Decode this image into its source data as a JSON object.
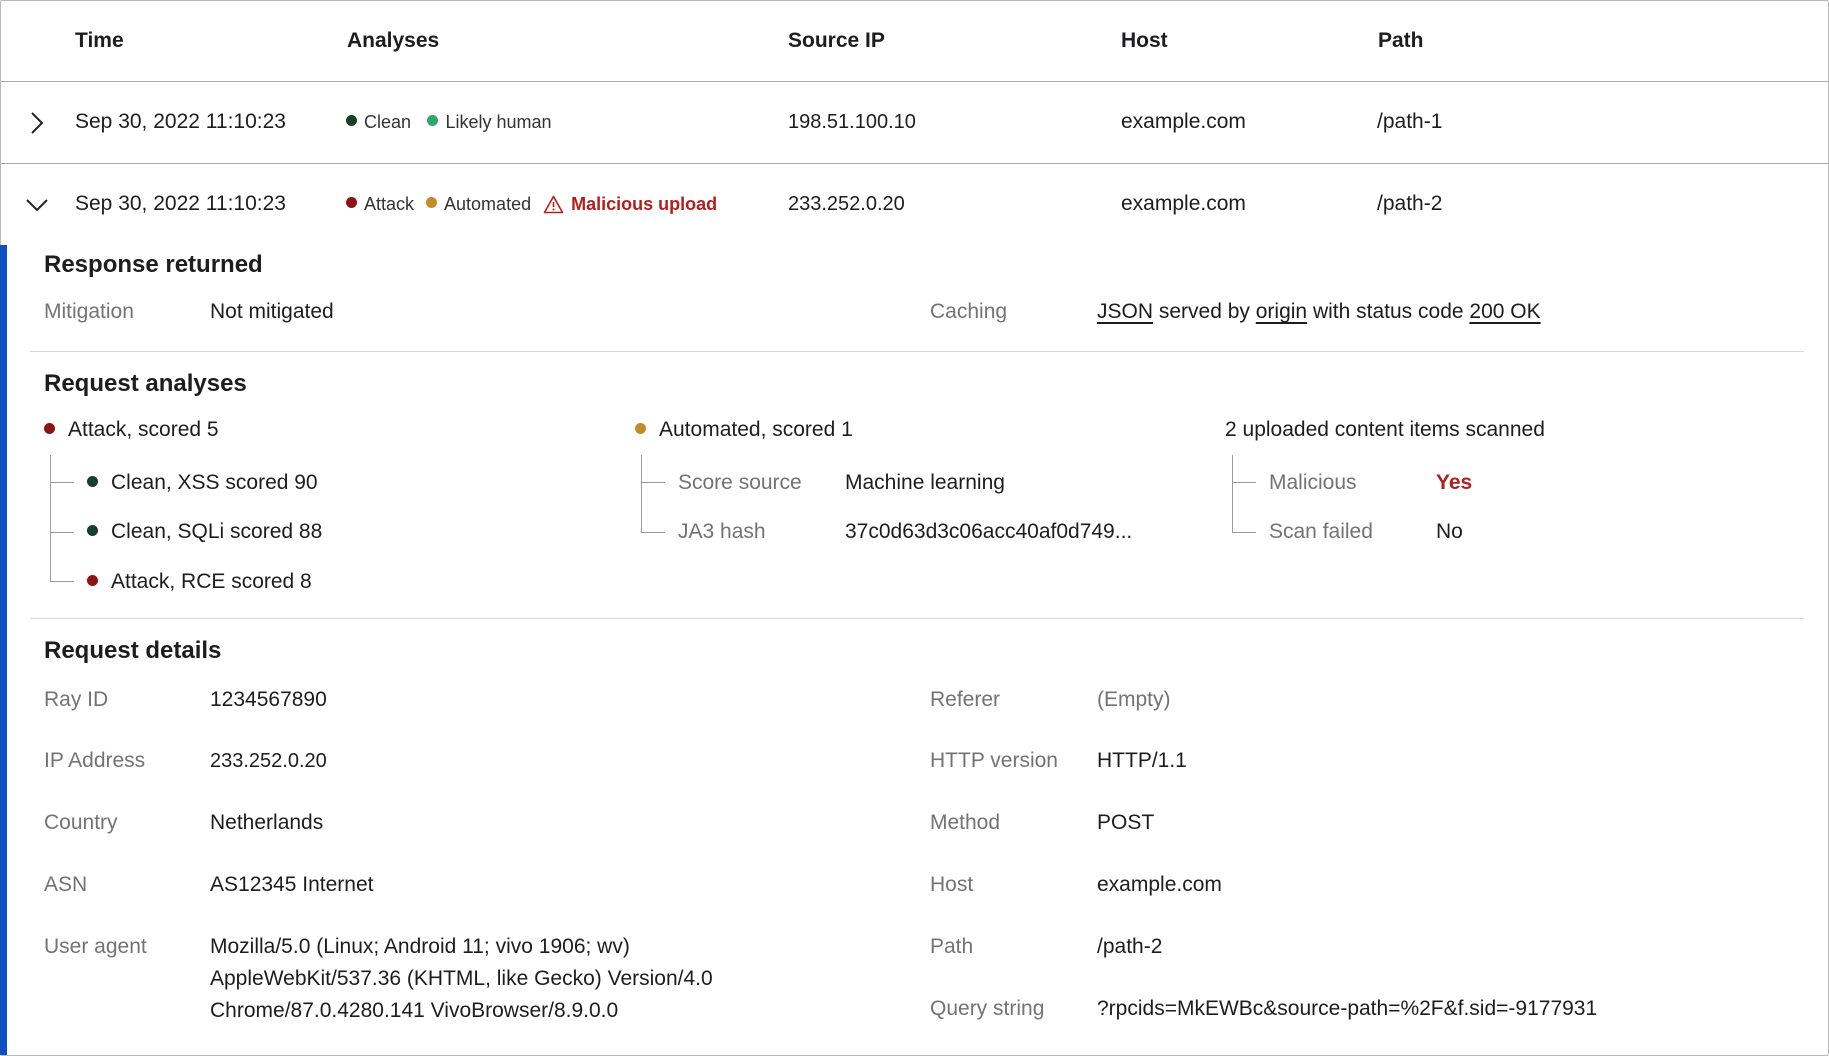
{
  "table": {
    "headers": {
      "time": "Time",
      "analyses": "Analyses",
      "source_ip": "Source IP",
      "host": "Host",
      "path": "Path"
    },
    "rows": [
      {
        "time": "Sep 30, 2022 11:10:23",
        "analyses": [
          {
            "label": "Clean",
            "color": "#173f2a"
          },
          {
            "label": "Likely human",
            "color": "#2fa66a"
          }
        ],
        "source_ip": "198.51.100.10",
        "host": "example.com",
        "path": "/path-1",
        "expanded": false
      },
      {
        "time": "Sep 30, 2022 11:10:23",
        "analyses": [
          {
            "label": "Attack",
            "color": "#8b1414"
          },
          {
            "label": "Automated",
            "color": "#c48a2c"
          }
        ],
        "warning": {
          "label": "Malicious upload",
          "icon": "warning-triangle-icon",
          "color": "#b1201c"
        },
        "source_ip": "233.252.0.20",
        "host": "example.com",
        "path": "/path-2",
        "expanded": true
      }
    ]
  },
  "detail": {
    "response": {
      "title": "Response returned",
      "mitigation_label": "Mitigation",
      "mitigation_value": "Not mitigated",
      "caching_label": "Caching",
      "caching": {
        "content_type": "JSON",
        "text1": "served by",
        "origin": "origin",
        "text2": "with status code",
        "status": "200 OK"
      }
    },
    "analyses": {
      "title": "Request analyses",
      "attack": {
        "summary": "Attack, scored 5",
        "color": "#8b1414",
        "items": [
          {
            "label": "Clean, XSS scored 90",
            "color": "#173f2a"
          },
          {
            "label": "Clean, SQLi scored 88",
            "color": "#173f2a"
          },
          {
            "label": "Attack, RCE scored 8",
            "color": "#8b1414"
          }
        ]
      },
      "automated": {
        "summary": "Automated, scored 1",
        "color": "#c48a2c",
        "score_source_label": "Score source",
        "score_source_value": "Machine learning",
        "ja3_label": "JA3 hash",
        "ja3_value": "37c0d63d3c06acc40af0d749..."
      },
      "upload": {
        "summary": "2 uploaded content items scanned",
        "malicious_label": "Malicious",
        "malicious_value": "Yes",
        "scan_failed_label": "Scan failed",
        "scan_failed_value": "No"
      }
    },
    "details": {
      "title": "Request details",
      "left": [
        {
          "label": "Ray ID",
          "value": "1234567890"
        },
        {
          "label": "IP Address",
          "value": "233.252.0.20"
        },
        {
          "label": "Country",
          "value": "Netherlands"
        },
        {
          "label": "ASN",
          "value": "AS12345 Internet"
        },
        {
          "label": "User agent",
          "lines": [
            "Mozilla/5.0 (Linux; Android 11; vivo 1906; wv)",
            "AppleWebKit/537.36 (KHTML, like Gecko) Version/4.0",
            "Chrome/87.0.4280.141 VivoBrowser/8.9.0.0"
          ]
        }
      ],
      "right": [
        {
          "label": "Referer",
          "value": "(Empty)"
        },
        {
          "label": "HTTP version",
          "value": "HTTP/1.1"
        },
        {
          "label": "Method",
          "value": "POST"
        },
        {
          "label": "Host",
          "value": "example.com"
        },
        {
          "label": "Path",
          "value": "/path-2"
        },
        {
          "label": "Query string",
          "value": "?rpcids=MkEWBc&source-path=%2F&f.sid=-9177931"
        }
      ]
    }
  },
  "colors": {
    "accent": "#0f4fbf",
    "danger": "#b1201c"
  }
}
